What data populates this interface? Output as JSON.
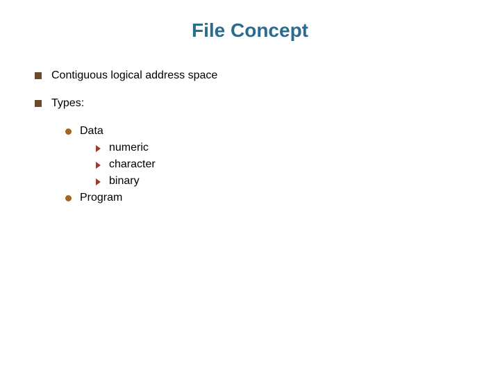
{
  "slide": {
    "title": "File Concept",
    "bullets": {
      "item1": "Contiguous logical address space",
      "item2": "Types:",
      "sub1": "Data",
      "subsub1": "numeric",
      "subsub2": "character",
      "subsub3": "binary",
      "sub2": "Program"
    }
  }
}
